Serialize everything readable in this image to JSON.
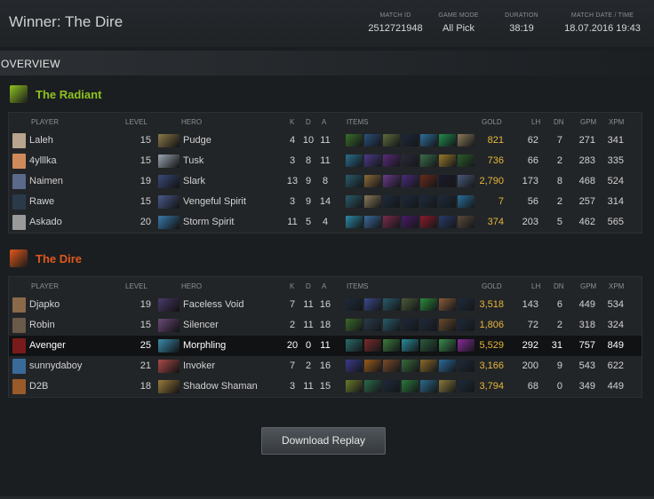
{
  "header": {
    "winner": "Winner: The Dire",
    "meta": [
      {
        "label": "MATCH ID",
        "value": "2512721948"
      },
      {
        "label": "GAME MODE",
        "value": "All Pick"
      },
      {
        "label": "DURATION",
        "value": "38:19"
      },
      {
        "label": "MATCH DATE / TIME",
        "value": "18.07.2016 19:43"
      }
    ]
  },
  "section": {
    "overview": "OVERVIEW"
  },
  "columns": {
    "player": "PLAYER",
    "level": "LEVEL",
    "hero": "HERO",
    "k": "K",
    "d": "D",
    "a": "A",
    "items": "ITEMS",
    "gold": "GOLD",
    "lh": "LH",
    "dn": "DN",
    "gpm": "GPM",
    "xpm": "XPM"
  },
  "teams": [
    {
      "name": "The Radiant",
      "color": "#8fc31f",
      "players": [
        {
          "player": "Laleh",
          "level": "15",
          "hero": "Pudge",
          "k": "4",
          "d": "10",
          "a": "11",
          "gold": "821",
          "lh": "62",
          "dn": "7",
          "gpm": "271",
          "xpm": "341",
          "avatar_color": "#b9a48d",
          "hero_color": "#8a7a4a",
          "items": [
            "#3a6e2a",
            "#2a4f7a",
            "#5e6b3a",
            "#1e2a3a",
            "#2e6e9a",
            "#1f8e4a",
            "#8a7a5a"
          ]
        },
        {
          "player": "4ylllka",
          "level": "15",
          "hero": "Tusk",
          "k": "3",
          "d": "8",
          "a": "11",
          "gold": "736",
          "lh": "66",
          "dn": "2",
          "gpm": "283",
          "xpm": "335",
          "avatar_color": "#d08a5a",
          "hero_color": "#9aa6b3",
          "items": [
            "#2a6e8e",
            "#4a3a8a",
            "#5a2a7a",
            "#2a2a3a",
            "#3a6e4a",
            "#9a7a2a",
            "#2a5e2a"
          ]
        },
        {
          "player": "Naimen",
          "level": "19",
          "hero": "Slark",
          "k": "13",
          "d": "9",
          "a": "8",
          "gold": "2,790",
          "lh": "173",
          "dn": "8",
          "gpm": "468",
          "xpm": "524",
          "avatar_color": "#5a6a8a",
          "hero_color": "#3a4a7a",
          "items": [
            "#2a5a6a",
            "#8a6a3a",
            "#6a3a8a",
            "#4a2a7a",
            "#6a2a1a",
            "#1a1a2a",
            "#4a5a7a"
          ]
        },
        {
          "player": "Rawe",
          "level": "15",
          "hero": "Vengeful Spirit",
          "k": "3",
          "d": "9",
          "a": "14",
          "gold": "7",
          "lh": "56",
          "dn": "2",
          "gpm": "257",
          "xpm": "314",
          "avatar_color": "#2a3a4a",
          "hero_color": "#4a5a8a",
          "items": [
            "#2a5a6a",
            "#8a7a5a",
            "#1e2a3a",
            "#1e2a3a",
            "#1e2a3a",
            "#1e2a3a",
            "#2a6e9a"
          ]
        },
        {
          "player": "Askado",
          "level": "20",
          "hero": "Storm Spirit",
          "k": "11",
          "d": "5",
          "a": "4",
          "gold": "374",
          "lh": "203",
          "dn": "5",
          "gpm": "462",
          "xpm": "565",
          "avatar_color": "#9a9a9a",
          "hero_color": "#3a7aaa",
          "items": [
            "#2a8aa8",
            "#3a6a9a",
            "#7a2a4a",
            "#4a1a6a",
            "#8a1a2a",
            "#2a3a6a",
            "#5a4a3a"
          ]
        }
      ]
    },
    {
      "name": "The Dire",
      "color": "#e0571b",
      "players": [
        {
          "player": "Djapko",
          "level": "19",
          "hero": "Faceless Void",
          "k": "7",
          "d": "11",
          "a": "16",
          "gold": "3,518",
          "lh": "143",
          "dn": "6",
          "gpm": "449",
          "xpm": "534",
          "avatar_color": "#8a6a4a",
          "hero_color": "#4a3a6a",
          "items": [
            "#1e2a3a",
            "#3a4a8a",
            "#2a5a6a",
            "#4a5a3a",
            "#2a8a3a",
            "#8a5a3a",
            "#1e2a3a"
          ]
        },
        {
          "player": "Robin",
          "level": "15",
          "hero": "Silencer",
          "k": "2",
          "d": "11",
          "a": "18",
          "gold": "1,806",
          "lh": "72",
          "dn": "2",
          "gpm": "318",
          "xpm": "324",
          "avatar_color": "#6a5a4a",
          "hero_color": "#6a4a7a",
          "items": [
            "#3a6a2a",
            "#2a3a4a",
            "#2a5a6a",
            "#1e2a3a",
            "#1e2a3a",
            "#6a4a2a",
            "#1e2a3a"
          ]
        },
        {
          "player": "Avenger",
          "level": "25",
          "hero": "Morphling",
          "k": "20",
          "d": "0",
          "a": "11",
          "gold": "5,529",
          "lh": "292",
          "dn": "31",
          "gpm": "757",
          "xpm": "849",
          "avatar_color": "#7a1a1a",
          "hero_color": "#3a8aaa",
          "items": [
            "#2a6a6a",
            "#7a2a2a",
            "#3a7a3a",
            "#2a8a9a",
            "#2a5a3a",
            "#3a8a4a",
            "#8a2a9a"
          ]
        },
        {
          "player": "sunnydaboy",
          "level": "21",
          "hero": "Invoker",
          "k": "7",
          "d": "2",
          "a": "16",
          "gold": "3,166",
          "lh": "200",
          "dn": "9",
          "gpm": "543",
          "xpm": "622",
          "avatar_color": "#3a6a9a",
          "hero_color": "#aa4a4a",
          "items": [
            "#3a3a8a",
            "#9a5a1a",
            "#7a4a2a",
            "#3a6a3a",
            "#8a6a2a",
            "#2a6a9a",
            "#1e2a3a"
          ]
        },
        {
          "player": "D2B",
          "level": "18",
          "hero": "Shadow Shaman",
          "k": "3",
          "d": "11",
          "a": "15",
          "gold": "3,794",
          "lh": "68",
          "dn": "0",
          "gpm": "349",
          "xpm": "449",
          "avatar_color": "#9a5a2a",
          "hero_color": "#9a7a3a",
          "items": [
            "#6a7a2a",
            "#2a6a4a",
            "#1e2a3a",
            "#2a7a3a",
            "#2a6a8a",
            "#8a7a3a",
            "#1e2a3a"
          ]
        }
      ]
    }
  ],
  "highlight_player": "Avenger",
  "buttons": {
    "download": "Download Replay"
  }
}
